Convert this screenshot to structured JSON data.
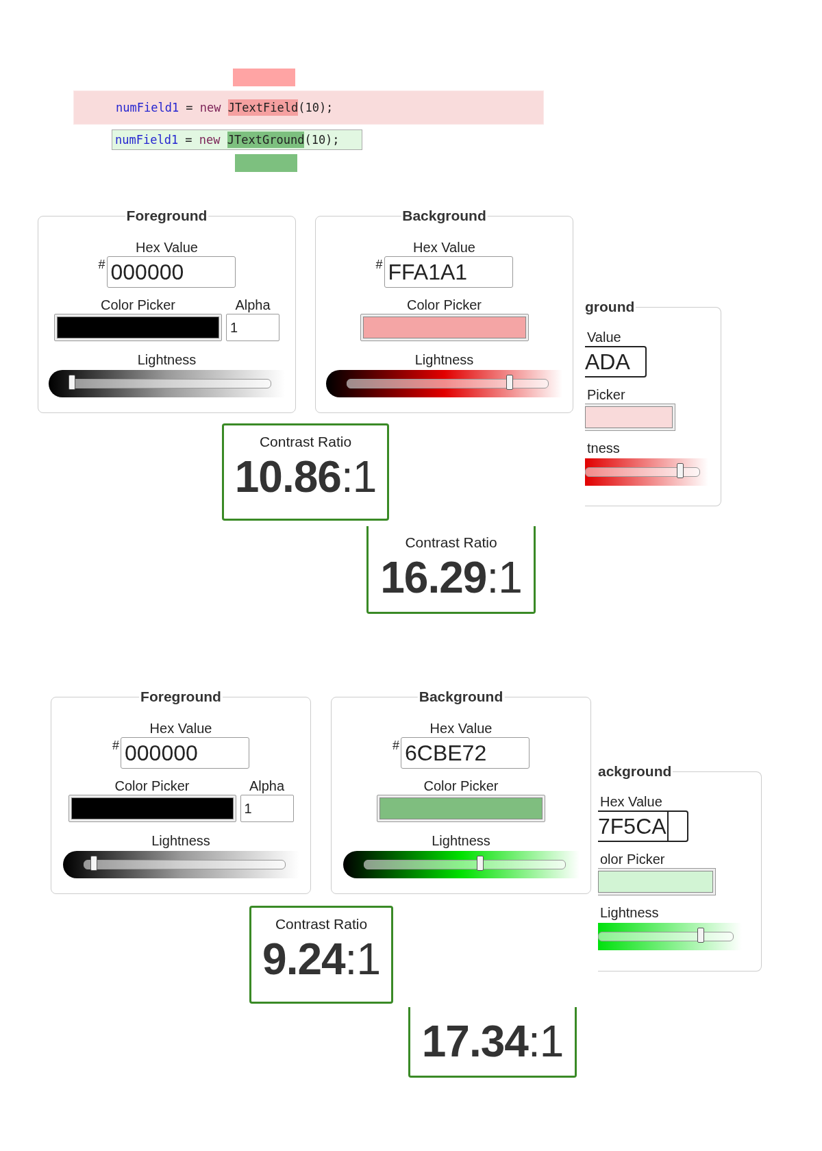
{
  "code_diff": {
    "removed": {
      "variable": "numField1",
      "operator": "=",
      "keyword": "new",
      "class_name": "JTextField",
      "rest": "(10);"
    },
    "added": {
      "variable": "numField1",
      "operator": "=",
      "keyword": "new",
      "class_name": "JTextGround",
      "rest": "(10);"
    }
  },
  "comparisons": [
    {
      "panels": [
        {
          "title": "Foreground",
          "hex_label": "Hex Value",
          "hash": "#",
          "hex_value": "000000",
          "picker_label": "Color Picker",
          "color": "#000000",
          "alpha_label": "Alpha",
          "alpha_value": "1",
          "lightness_label": "Lightness",
          "level": 0.01
        },
        {
          "title": "Background",
          "hex_label": "Hex Value",
          "hash": "#",
          "hex_value": "FFA1A1",
          "picker_label": "Color Picker",
          "color": "#f4a5a5",
          "lightness_label": "Lightness",
          "level": 0.81
        }
      ],
      "ratio": {
        "label": "Contrast Ratio",
        "value": "**10.86**:1"
      },
      "cropped_panel": {
        "title": "ground",
        "hex_label": "Value",
        "hex_value": "ADA",
        "caret": false,
        "picker_label": "Picker",
        "color": "#f9dada",
        "lightness_label": "tness",
        "level": 0.83
      },
      "cropped_ratio": {
        "label": "Contrast Ratio",
        "value": "**16.29**:1"
      }
    },
    {
      "panels": [
        {
          "title": "Foreground",
          "hex_label": "Hex Value",
          "hash": "#",
          "hex_value": "000000",
          "picker_label": "Color Picker",
          "color": "#000000",
          "alpha_label": "Alpha",
          "alpha_value": "1",
          "lightness_label": "Lightness",
          "level": 0.05
        },
        {
          "title": "Background",
          "hex_label": "Hex Value",
          "hash": "#",
          "hex_value": "6CBE72",
          "picker_label": "Color Picker",
          "color": "#7fbe7f",
          "lightness_label": "Lightness",
          "level": 0.58
        }
      ],
      "ratio": {
        "label": "Contrast Ratio",
        "value": "**9.24**:1"
      },
      "cropped_panel": {
        "title": "ackground",
        "hex_label": "Hex Value",
        "hex_value": "7F5CA",
        "caret": true,
        "picker_label": "olor Picker",
        "color": "#d2f4d4",
        "lightness_label": "Lightness",
        "level": 0.76
      },
      "cropped_ratio": {
        "value": "**17.34**:1"
      }
    }
  ]
}
